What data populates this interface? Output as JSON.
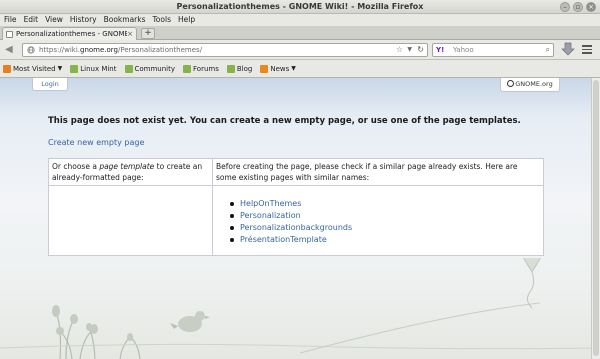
{
  "window": {
    "title": "Personalizationthemes - GNOME Wiki! - Mozilla Firefox"
  },
  "menu": [
    "File",
    "Edit",
    "View",
    "History",
    "Bookmarks",
    "Tools",
    "Help"
  ],
  "tab": {
    "label": "Personalizationthemes - GNOME W...",
    "close": "×",
    "new_tab": "+"
  },
  "nav": {
    "url_host_prefix": "https://wiki.",
    "url_domain": "gnome.org",
    "url_path": "/Personalizationthemes/",
    "search_engine": "Y!",
    "search_placeholder": "Yahoo"
  },
  "bookmarks": [
    {
      "label": "Most Visited",
      "dropdown": true,
      "color": "#e67e22"
    },
    {
      "label": "Linux Mint",
      "dropdown": false,
      "color": "#87b34d"
    },
    {
      "label": "Community",
      "dropdown": false,
      "color": "#87b34d"
    },
    {
      "label": "Forums",
      "dropdown": false,
      "color": "#87b34d"
    },
    {
      "label": "Blog",
      "dropdown": false,
      "color": "#87b34d"
    },
    {
      "label": "News",
      "dropdown": true,
      "color": "#e8891c"
    }
  ],
  "page": {
    "login": "Login",
    "logo": "GNOME.org",
    "not_exist": "This page does not exist yet. You can create a new empty page, or use one of the page templates.",
    "create_link": "Create new empty page",
    "cell1_prefix": "Or choose a ",
    "cell1_em": "page template",
    "cell1_suffix": " to create an already-formatted page:",
    "cell2": "Before creating the page, please check if a similar page already exists. Here are some existing pages with similar names:",
    "similar_pages": [
      "HelpOnThemes",
      "Personalization",
      "Personalizationbackgrounds",
      "PrésentationTemplate"
    ]
  },
  "colors": {
    "link": "#3465a4",
    "accent": "#b8cade"
  }
}
